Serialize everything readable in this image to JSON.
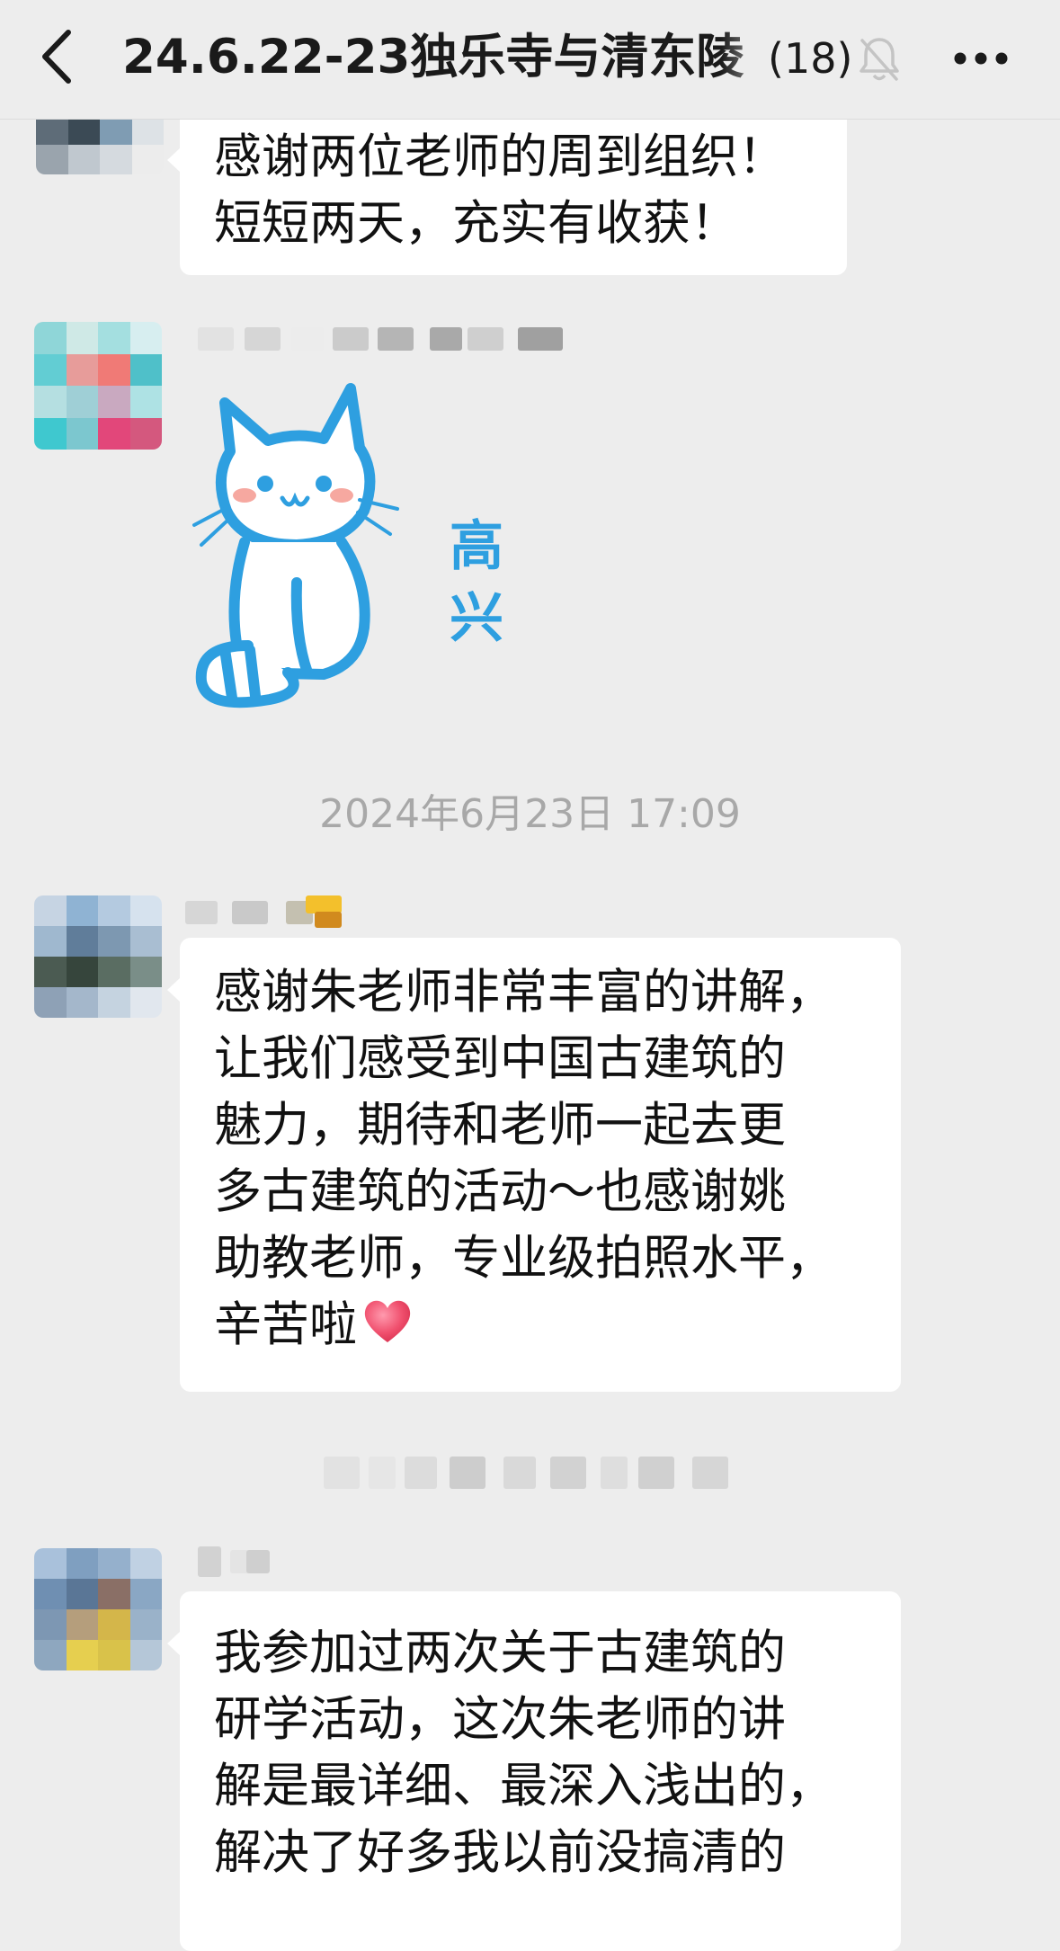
{
  "header": {
    "title": "24.6.22-23独乐寺与清东陵",
    "member_count": "(18)",
    "back_icon": "chevron-left-icon",
    "mute_icon": "bell-muted-icon",
    "more_icon": "more-dots-icon"
  },
  "messages": [
    {
      "lines": [
        "感谢两位老师的周到组织！",
        "短短两天，充实有收获！"
      ]
    },
    {
      "type": "sticker",
      "sticker_text": "高兴"
    },
    {
      "lines": [
        "感谢朱老师非常丰富的讲解，",
        "让我们感受到中国古建筑的",
        "魅力，期待和老师一起去更",
        "多古建筑的活动～也感谢姚",
        "助教老师，专业级拍照水平，",
        "辛苦啦"
      ],
      "emoji": "heart-emoji"
    },
    {
      "lines": [
        "我参加过两次关于古建筑的",
        "研学活动，这次朱老师的讲",
        "解是最详细、最深入浅出的，",
        "解决了好多我以前没搞清的"
      ]
    }
  ],
  "timestamp": "2024年6月23日 17:09",
  "colors": {
    "background": "#ededed",
    "bubble": "#ffffff",
    "sticker_blue": "#2e9fe0",
    "timestamp": "#a8a8a8",
    "heart": "#f0506e"
  }
}
